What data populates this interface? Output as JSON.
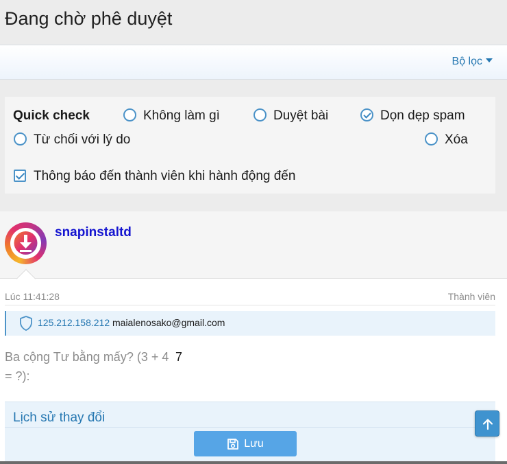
{
  "page": {
    "title": "Đang chờ phê duyệt"
  },
  "filter": {
    "label": "Bộ lọc"
  },
  "quick_check": {
    "label": "Quick check",
    "options": [
      {
        "label": "Không làm gì",
        "checked": false
      },
      {
        "label": "Duyệt bài",
        "checked": false
      },
      {
        "label": "Dọn dẹp spam",
        "checked": true
      },
      {
        "label": "Từ chối với lý do",
        "checked": false
      },
      {
        "label": "Xóa",
        "checked": false
      }
    ],
    "notify": {
      "label": "Thông báo đến thành viên khi hành động đến",
      "checked": true
    }
  },
  "post": {
    "username": "snapinstaltd",
    "time": "Lúc 11:41:28",
    "role": "Thành viên",
    "ip": "125.212.158.212",
    "email": "maialenosako@gmail.com",
    "question": "Ba cộng Tư bằng mấy? (3 + 4 = ?):",
    "answer": "7"
  },
  "history": {
    "title": "Lịch sử thay đổi"
  },
  "save_button": {
    "label": "Lưu"
  },
  "icons": {
    "filter": "caret-down-icon",
    "avatar": "download-icon",
    "ip": "shield-icon",
    "save": "floppy-disk-icon",
    "scroll": "arrow-up-icon"
  },
  "colors": {
    "accent": "#2577b1",
    "button": "#56a5e6",
    "username": "#1414d0"
  }
}
